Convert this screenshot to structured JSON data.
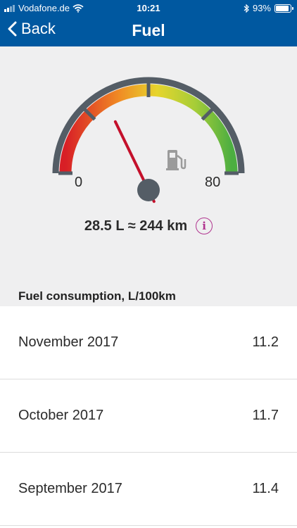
{
  "status_bar": {
    "carrier": "Vodafone.de",
    "time": "10:21",
    "battery": "93%"
  },
  "nav": {
    "back_label": "Back",
    "title": "Fuel"
  },
  "gauge": {
    "min_label": "0",
    "max_label": "80",
    "value_liters": 28.5,
    "reading": "28.5 L ≈ 244 km"
  },
  "consumption": {
    "title": "Fuel consumption, L/100km",
    "rows": [
      {
        "month": "November 2017",
        "value": "11.2"
      },
      {
        "month": "October 2017",
        "value": "11.7"
      },
      {
        "month": "September 2017",
        "value": "11.4"
      }
    ]
  },
  "colors": {
    "header": "#0058a0",
    "gauge_frame": "#545d66",
    "needle": "#c4102b",
    "info_accent": "#b0348f"
  }
}
